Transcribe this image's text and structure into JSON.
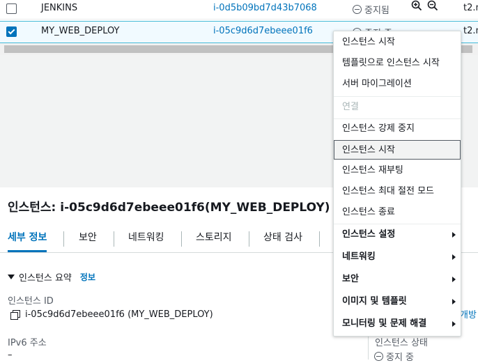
{
  "table": {
    "rows": [
      {
        "name": "JENKINS",
        "instance_id": "i-0d5b09bd7d43b7068",
        "state": "중지됨",
        "type": "t2.m",
        "checked": false
      },
      {
        "name": "MY_WEB_DEPLOY",
        "instance_id": "i-05c9d6d7ebeee01f6",
        "state": "중지 중",
        "type": "t2.n",
        "checked": true
      }
    ]
  },
  "icons": {
    "zoom_in": "zoom-in-icon",
    "zoom_out": "zoom-out-icon",
    "stopped": "stop-circle-icon",
    "copy": "copy-icon",
    "checkbox": "checkbox-icon"
  },
  "detail": {
    "title": "인스턴스: i-05c9d6d7ebeee01f6(MY_WEB_DEPLOY)",
    "tabs": [
      "세부 정보",
      "보안",
      "네트워킹",
      "스토리지",
      "상태 검사"
    ],
    "section_title": "인스턴스 요약",
    "section_info": "정보",
    "instance_id_label": "인스턴스 ID",
    "instance_id_value": "i-05c9d6d7ebeee01f6 (MY_WEB_DEPLOY)",
    "ipv6_label": "IPv6 주소",
    "ipv6_value": "–",
    "right_link": "개방",
    "right_label": "인스턴스 상태",
    "right_value": "중지 중"
  },
  "menu": {
    "items": [
      {
        "label": "인스턴스 시작",
        "disabled": false
      },
      {
        "label": "템플릿으로 인스턴스 시작",
        "disabled": false
      },
      {
        "label": "서버 마이그레이션",
        "disabled": false
      },
      {
        "label": "연결",
        "disabled": true
      },
      {
        "label": "인스턴스 강제 중지",
        "disabled": false
      },
      {
        "label": "인스턴스 시작",
        "disabled": false,
        "selected": true
      },
      {
        "label": "인스턴스 재부팅",
        "disabled": false
      },
      {
        "label": "인스턴스 최대 절전 모드",
        "disabled": false
      },
      {
        "label": "인스턴스 종료",
        "disabled": false
      },
      {
        "label": "인스턴스 설정",
        "submenu": true
      },
      {
        "label": "네트워킹",
        "submenu": true
      },
      {
        "label": "보안",
        "submenu": true
      },
      {
        "label": "이미지 및 템플릿",
        "submenu": true
      },
      {
        "label": "모니터링 및 문제 해결",
        "submenu": true
      }
    ]
  },
  "colors": {
    "accent": "#0073bb",
    "selected_row_bg": "#f1faff",
    "text": "#16191f"
  }
}
